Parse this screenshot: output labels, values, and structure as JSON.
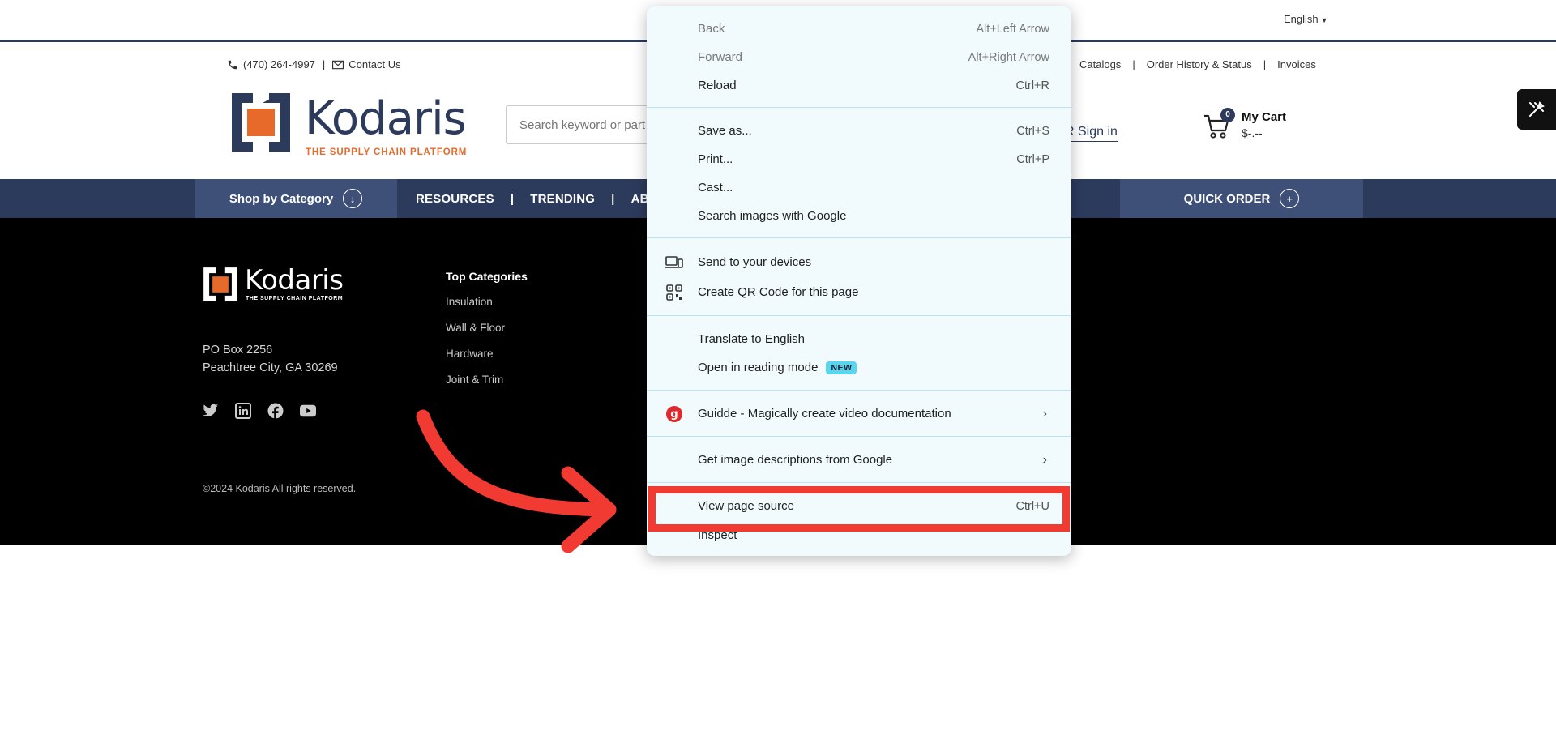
{
  "lang_bar": {
    "language": "English"
  },
  "header": {
    "phone": "(470) 264-4997",
    "contact": "Contact Us",
    "right_links": [
      "Catalogs",
      "Order History & Status",
      "Invoices"
    ],
    "logo_name": "Kodaris",
    "logo_tagline": "THE SUPPLY CHAIN PLATFORM",
    "search_placeholder": "Search keyword or part",
    "signin": "R Sign in",
    "cart_count": "0",
    "cart_title": "My Cart",
    "cart_total": "$-.--"
  },
  "nav": {
    "shop_by_category": "Shop by Category",
    "links": [
      "RESOURCES",
      "TRENDING",
      "AB"
    ],
    "quick_order": "QUICK ORDER"
  },
  "footer": {
    "logo_name": "Kodaris",
    "logo_tagline": "THE SUPPLY CHAIN PLATFORM",
    "address_line1": "PO Box 2256",
    "address_line2": "Peachtree City, GA 30269",
    "social": [
      "twitter-icon",
      "linkedin-icon",
      "facebook-icon",
      "youtube-icon"
    ],
    "top_categories_title": "Top Categories",
    "top_categories": [
      "Insulation",
      "Wall & Floor",
      "Hardware",
      "Joint & Trim"
    ],
    "copyright": "©2024 Kodaris All rights reserved."
  },
  "context_menu": {
    "back": {
      "label": "Back",
      "shortcut": "Alt+Left Arrow"
    },
    "forward": {
      "label": "Forward",
      "shortcut": "Alt+Right Arrow"
    },
    "reload": {
      "label": "Reload",
      "shortcut": "Ctrl+R"
    },
    "save_as": {
      "label": "Save as...",
      "shortcut": "Ctrl+S"
    },
    "print": {
      "label": "Print...",
      "shortcut": "Ctrl+P"
    },
    "cast": {
      "label": "Cast..."
    },
    "search_images": {
      "label": "Search images with Google"
    },
    "send_devices": {
      "label": "Send to your devices"
    },
    "qr_code": {
      "label": "Create QR Code for this page"
    },
    "translate": {
      "label": "Translate to English"
    },
    "reading_mode": {
      "label": "Open in reading mode",
      "badge": "NEW"
    },
    "guidde": {
      "label": "Guidde - Magically create video documentation"
    },
    "image_desc": {
      "label": "Get image descriptions from Google"
    },
    "view_source": {
      "label": "View page source",
      "shortcut": "Ctrl+U"
    },
    "inspect": {
      "label": "Inspect"
    }
  },
  "colors": {
    "brand_navy": "#2c3a5c",
    "brand_orange": "#e86a2a",
    "highlight_red": "#f03a32",
    "menu_bg": "#f1fbfd"
  }
}
